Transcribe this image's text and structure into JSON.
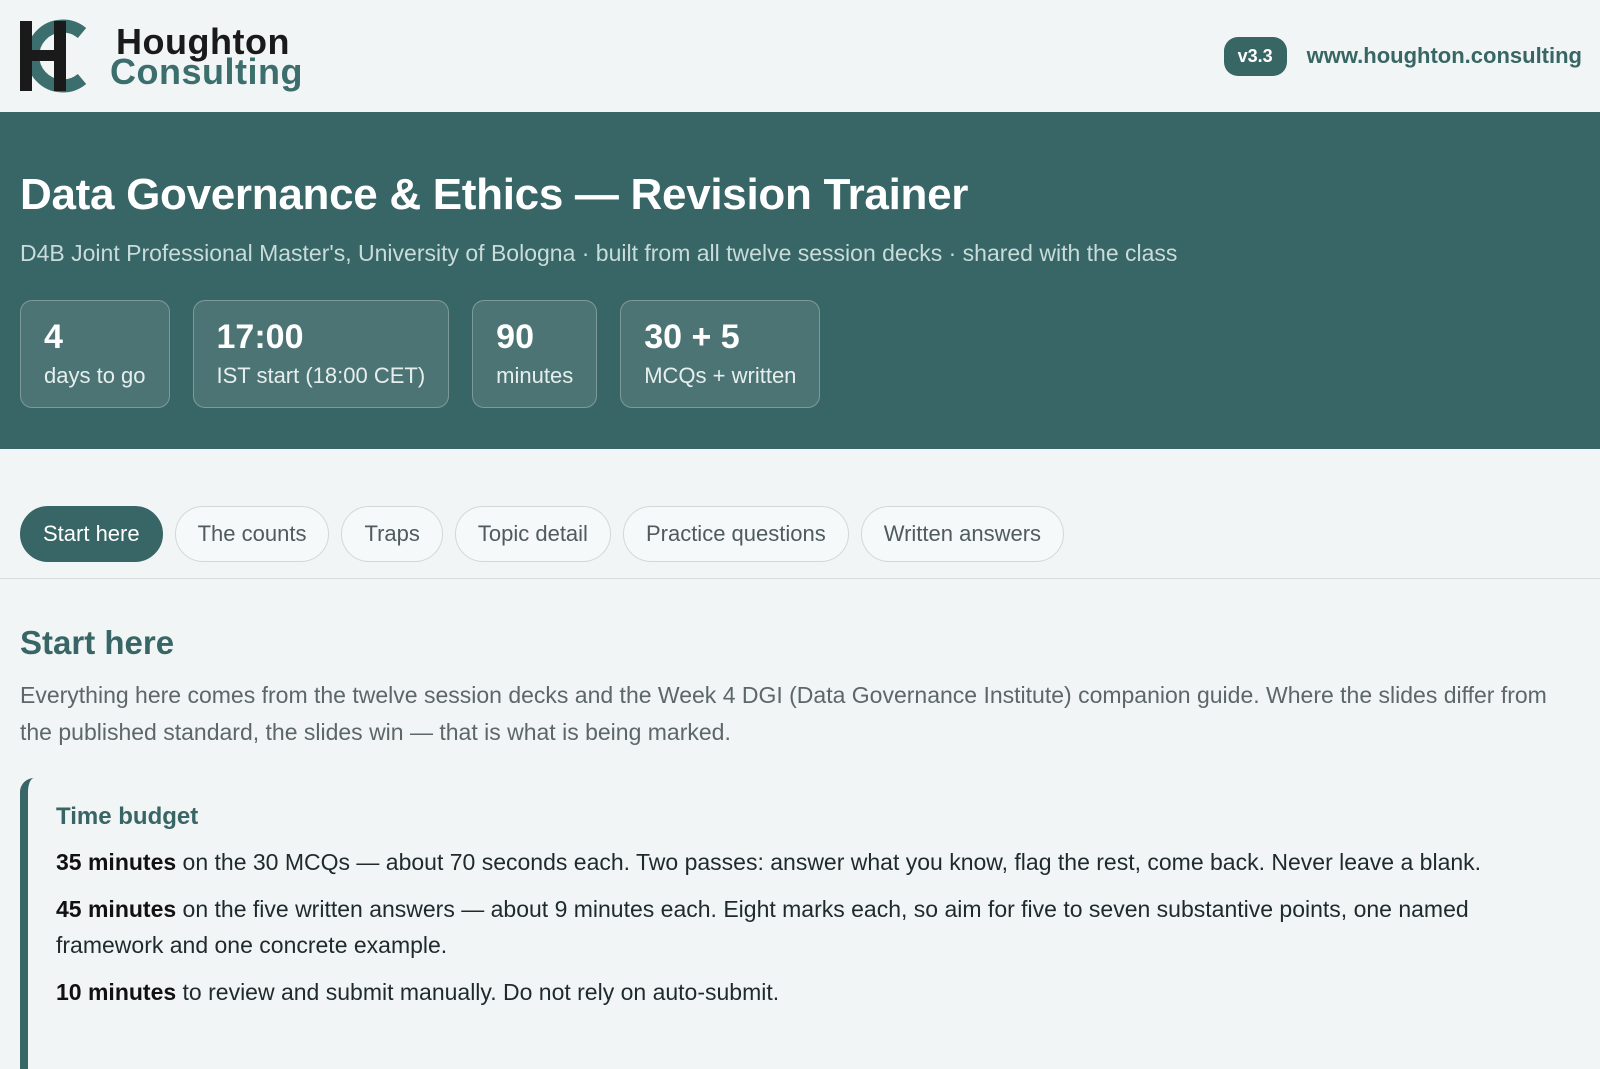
{
  "brand": {
    "logo_line1": "Houghton",
    "logo_line2": "Consulting",
    "version": "v3.3",
    "site": "www.houghton.consulting",
    "accent": "#386565"
  },
  "hero": {
    "title": "Data Governance & Ethics — Revision Trainer",
    "subtitle": "D4B Joint Professional Master's, University of Bologna · built from all twelve session decks · shared with the class",
    "stats": [
      {
        "value": "4",
        "label": "days to go"
      },
      {
        "value": "17:00",
        "label": "IST start (18:00 CET)"
      },
      {
        "value": "90",
        "label": "minutes"
      },
      {
        "value": "30 + 5",
        "label": "MCQs + written"
      }
    ]
  },
  "tabs": [
    {
      "label": "Start here",
      "active": true
    },
    {
      "label": "The counts",
      "active": false
    },
    {
      "label": "Traps",
      "active": false
    },
    {
      "label": "Topic detail",
      "active": false
    },
    {
      "label": "Practice questions",
      "active": false
    },
    {
      "label": "Written answers",
      "active": false
    }
  ],
  "main": {
    "heading": "Start here",
    "intro": "Everything here comes from the twelve session decks and the Week 4 DGI (Data Governance Institute) companion guide. Where the slides differ from the published standard, the slides win — that is what is being marked.",
    "callout": {
      "title": "Time budget",
      "items": [
        {
          "strong": "35 minutes",
          "text": " on the 30 MCQs — about 70 seconds each. Two passes: answer what you know, flag the rest, come back. Never leave a blank."
        },
        {
          "strong": "45 minutes",
          "text": " on the five written answers — about 9 minutes each. Eight marks each, so aim for five to seven substantive points, one named framework and one concrete example."
        },
        {
          "strong": "10 minutes",
          "text": " to review and submit manually. Do not rely on auto-submit."
        }
      ]
    }
  }
}
